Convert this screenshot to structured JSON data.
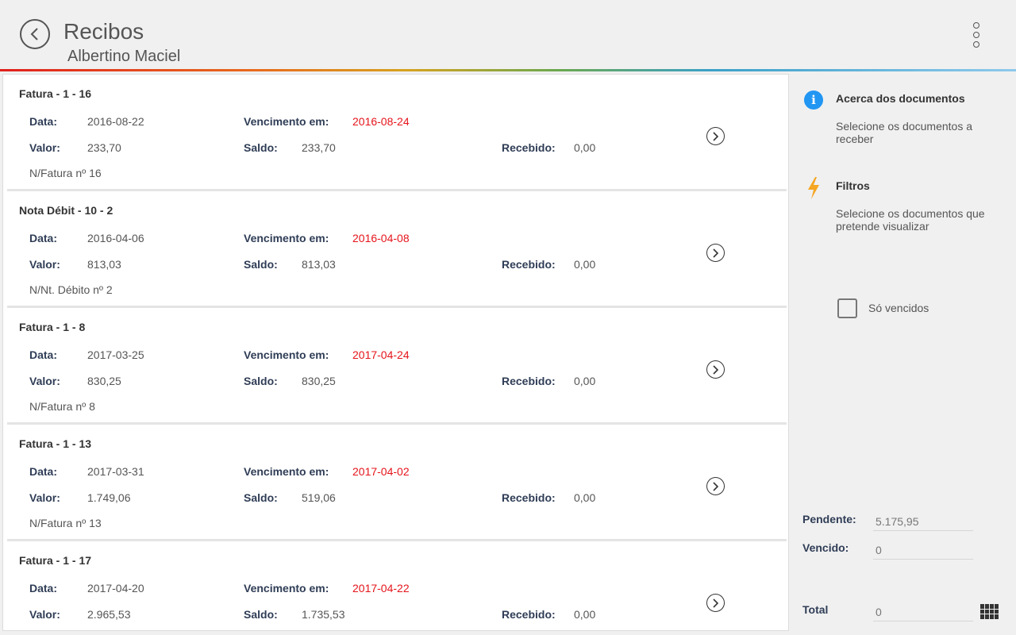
{
  "header": {
    "title": "Recibos",
    "subtitle": "Albertino Maciel"
  },
  "labels": {
    "data": "Data:",
    "vencimento": "Vencimento em:",
    "valor": "Valor:",
    "saldo": "Saldo:",
    "recebido": "Recebido:"
  },
  "documents": [
    {
      "title": "Fatura - 1 - 16",
      "data": "2016-08-22",
      "vencimento": "2016-08-24",
      "valor": "233,70",
      "saldo": "233,70",
      "recebido": "0,00",
      "note": "N/Fatura nº 16"
    },
    {
      "title": "Nota Débit - 10 - 2",
      "data": "2016-04-06",
      "vencimento": "2016-04-08",
      "valor": "813,03",
      "saldo": "813,03",
      "recebido": "0,00",
      "note": "N/Nt. Débito nº 2"
    },
    {
      "title": "Fatura - 1 - 8",
      "data": "2017-03-25",
      "vencimento": "2017-04-24",
      "valor": "830,25",
      "saldo": "830,25",
      "recebido": "0,00",
      "note": "N/Fatura nº 8"
    },
    {
      "title": "Fatura - 1 - 13",
      "data": "2017-03-31",
      "vencimento": "2017-04-02",
      "valor": "1.749,06",
      "saldo": "519,06",
      "recebido": "0,00",
      "note": "N/Fatura nº 13"
    },
    {
      "title": "Fatura - 1 - 17",
      "data": "2017-04-20",
      "vencimento": "2017-04-22",
      "valor": "2.965,53",
      "saldo": "1.735,53",
      "recebido": "0,00",
      "note": ""
    }
  ],
  "sidebar": {
    "about_title": "Acerca dos documentos",
    "about_text": "Selecione os documentos a receber",
    "filters_title": "Filtros",
    "filters_text": "Selecione os documentos que pretende visualizar",
    "only_overdue_label": "Só vencidos",
    "pendente_label": "Pendente:",
    "pendente_value": "5.175,95",
    "vencido_label": "Vencido:",
    "vencido_value": "0",
    "total_label": "Total",
    "total_value": "0"
  },
  "colors": {
    "accent_red": "#e5141b",
    "label_navy": "#2f3d56",
    "info_blue": "#2196f3",
    "filter_orange": "#f5a623"
  },
  "icons": [
    "back-arrow-icon",
    "more-vert-icon",
    "chevron-right-icon",
    "info-icon",
    "lightning-icon",
    "keypad-icon"
  ]
}
